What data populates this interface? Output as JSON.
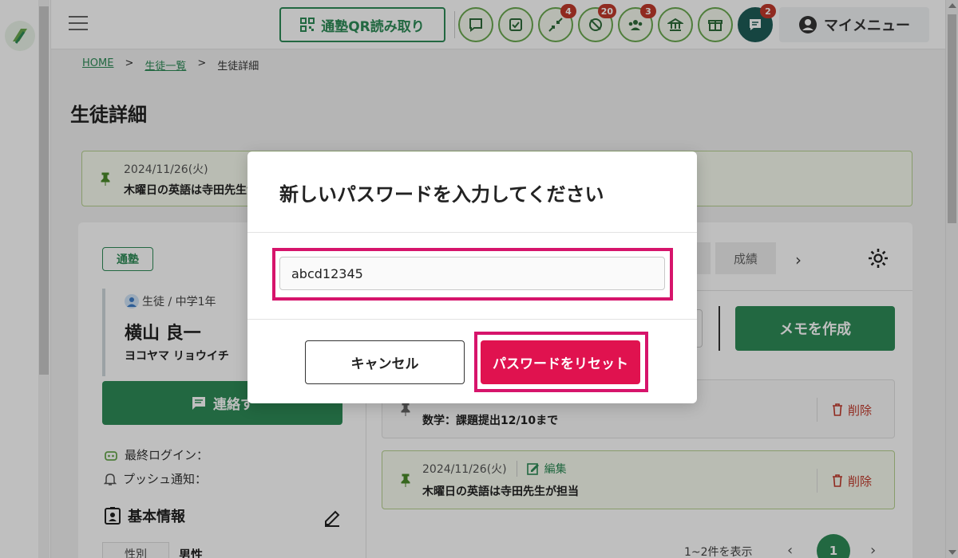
{
  "header": {
    "qr_label": "通塾QR読み取り",
    "icons": [
      {
        "name": "chat-icon",
        "badge": ""
      },
      {
        "name": "checklist-icon",
        "badge": ""
      },
      {
        "name": "arrows-in-icon",
        "badge": "4"
      },
      {
        "name": "no-location-icon",
        "badge": "20"
      },
      {
        "name": "group-icon",
        "badge": "3"
      },
      {
        "name": "bank-icon",
        "badge": ""
      },
      {
        "name": "gift-icon",
        "badge": ""
      },
      {
        "name": "message-icon",
        "badge": "2"
      }
    ],
    "mymenu_label": "マイメニュー"
  },
  "breadcrumb": {
    "home": "HOME",
    "students": "生徒一覧",
    "current": "生徒詳細",
    "sep": ">"
  },
  "page": {
    "title": "生徒詳細"
  },
  "pinned_note": {
    "date": "2024/11/26(火)",
    "text": "木曜日の英語は寺田先生が担当"
  },
  "student": {
    "status": "通塾",
    "role": "生徒 / 中学1年",
    "name": "横山 良一",
    "kana": "ヨコヤマ リョウイチ",
    "contact_label": "連絡す",
    "last_login": "最終ログイン：",
    "push_notice": "プッシュ通知：",
    "basic_info_title": "基本情報",
    "gender_label": "性別",
    "gender_value": "男性"
  },
  "tabs": {
    "grades": "成績",
    "next": "›"
  },
  "memo": {
    "create_label": "メモを作成",
    "items": [
      {
        "date": "",
        "text": "数学：課題提出12/10まで",
        "edit": "",
        "delete": "削除"
      },
      {
        "date": "2024/11/26(火)",
        "text": "木曜日の英語は寺田先生が担当",
        "edit": "編集",
        "delete": "削除"
      }
    ]
  },
  "pager": {
    "text": "1~2件を表示",
    "prev": "‹",
    "page": "1",
    "next": "›"
  },
  "modal": {
    "title": "新しいパスワードを入力してください",
    "password_value": "abcd12345",
    "cancel_label": "キャンセル",
    "reset_label": "パスワードをリセット"
  },
  "colors": {
    "brand": "#2e8b57",
    "danger": "#e0124f",
    "highlight": "#d6146b"
  }
}
